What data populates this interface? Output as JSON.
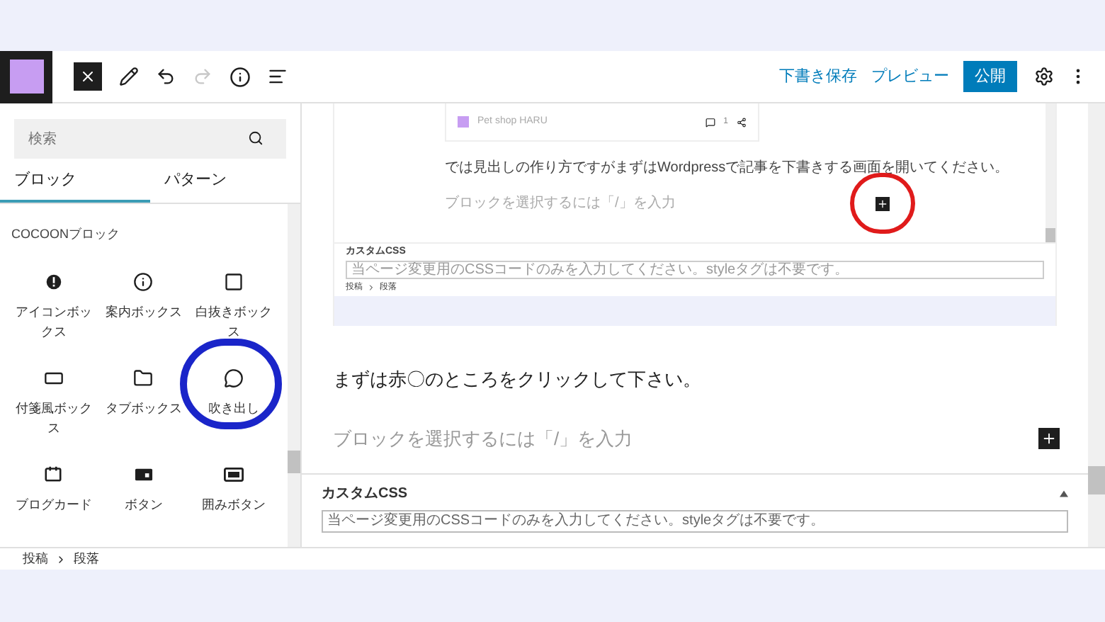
{
  "topbar": {
    "actions": [
      {
        "kind": "link",
        "label": "下書き保存"
      },
      {
        "kind": "link",
        "label": "プレビュー"
      },
      {
        "kind": "primary",
        "label": "公開"
      }
    ],
    "redo_disabled": true
  },
  "sidebar": {
    "search": {
      "placeholder": "検索"
    },
    "tabs": [
      {
        "label": "ブロック",
        "selected": true
      },
      {
        "label": "パターン",
        "selected": false
      }
    ],
    "category": "COCOONブロック",
    "blocks": [
      {
        "label": "アイコンボックス",
        "kind": "alert",
        "circled": false
      },
      {
        "label": "案内ボックス",
        "kind": "info",
        "circled": false
      },
      {
        "label": "白抜きボックス",
        "kind": "square",
        "circled": false
      },
      {
        "label": "付箋風ボックス",
        "kind": "sticky",
        "circled": false
      },
      {
        "label": "タブボックス",
        "kind": "folder",
        "circled": false
      },
      {
        "label": "吹き出し",
        "kind": "balloon",
        "circled": true
      },
      {
        "label": "ブログカード",
        "kind": "card",
        "circled": false
      },
      {
        "label": "ボタン",
        "kind": "button",
        "circled": false
      },
      {
        "label": "囲みボタン",
        "kind": "framed",
        "circled": false
      }
    ]
  },
  "embedded_screenshot": {
    "card_title": "Pet shop HARU",
    "comment_count": "1",
    "paragraph": "では見出しの作り方ですがまずはWordpressで記事を下書きする画面を開いてください。",
    "placeholder": "ブロックを選択するには「/」を入力",
    "add_button_circled": true,
    "custom_css": {
      "title": "カスタムCSS",
      "placeholder": "当ページ変更用のCSSコードのみを入力してください。styleタグは不要です。"
    },
    "breadcrumb": [
      "投稿",
      "段落"
    ]
  },
  "editor": {
    "paragraph": "まずは赤〇のところをクリックして下さい。",
    "placeholder": "ブロックを選択するには「/」を入力"
  },
  "custom_css": {
    "title": "カスタムCSS",
    "placeholder": "当ページ変更用のCSSコードのみを入力してください。styleタグは不要です。"
  },
  "breadcrumb": [
    "投稿",
    "段落"
  ]
}
